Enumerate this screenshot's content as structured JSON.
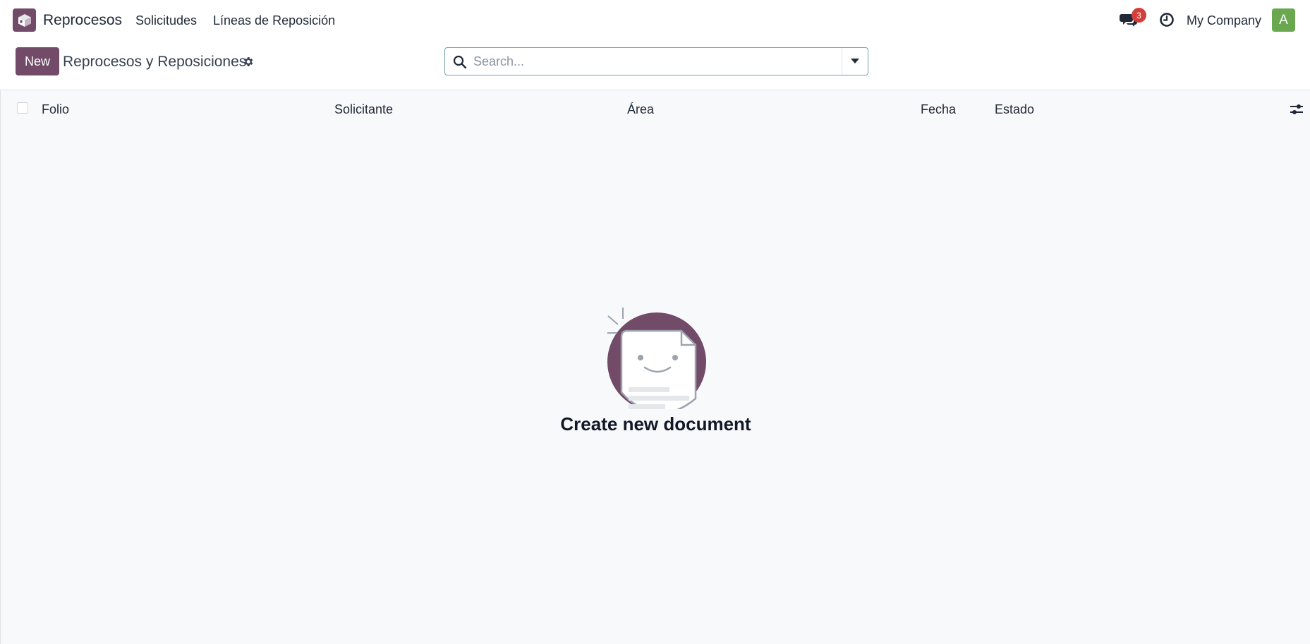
{
  "navbar": {
    "app_name": "Reprocesos",
    "menu": [
      {
        "label": "Solicitudes"
      },
      {
        "label": "Líneas de Reposición"
      }
    ],
    "messages_badge": "3",
    "company": "My Company",
    "avatar_initial": "A"
  },
  "control_panel": {
    "new_label": "New",
    "title": "Reprocesos y Reposiciones"
  },
  "search": {
    "placeholder": "Search..."
  },
  "list": {
    "columns": [
      {
        "label": "Folio"
      },
      {
        "label": "Solicitante"
      },
      {
        "label": "Área"
      },
      {
        "label": "Fecha"
      },
      {
        "label": "Estado"
      }
    ]
  },
  "empty_state": {
    "title": "Create new document"
  },
  "colors": {
    "brand": "#714b67",
    "badge": "#d23f3a",
    "avatar": "#6aa84f",
    "content_bg": "#f8f9fa"
  }
}
